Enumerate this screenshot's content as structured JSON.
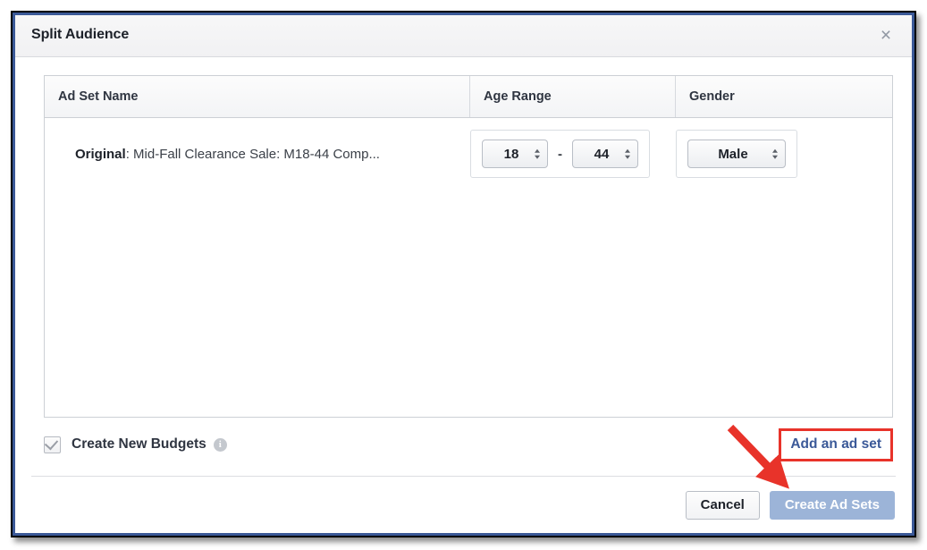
{
  "dialog": {
    "title": "Split Audience",
    "close_icon": "×"
  },
  "table": {
    "columns": [
      "Ad Set Name",
      "Age Range",
      "Gender"
    ],
    "rows": [
      {
        "name_prefix": "Original",
        "name_rest": ": Mid-Fall Clearance Sale: M18-44 Comp...",
        "age_min": "18",
        "age_max": "44",
        "age_separator": "-",
        "gender": "Male"
      }
    ]
  },
  "budgets": {
    "label": "Create New Budgets",
    "checked": true,
    "info_glyph": "i",
    "add_link": "Add an ad set"
  },
  "footer": {
    "cancel_label": "Cancel",
    "primary_label": "Create Ad Sets"
  },
  "colors": {
    "link_blue": "#3b5998",
    "primary_disabled": "#9cb4d8",
    "annotation_red": "#e8332a",
    "frame_blue": "#3b5998"
  }
}
